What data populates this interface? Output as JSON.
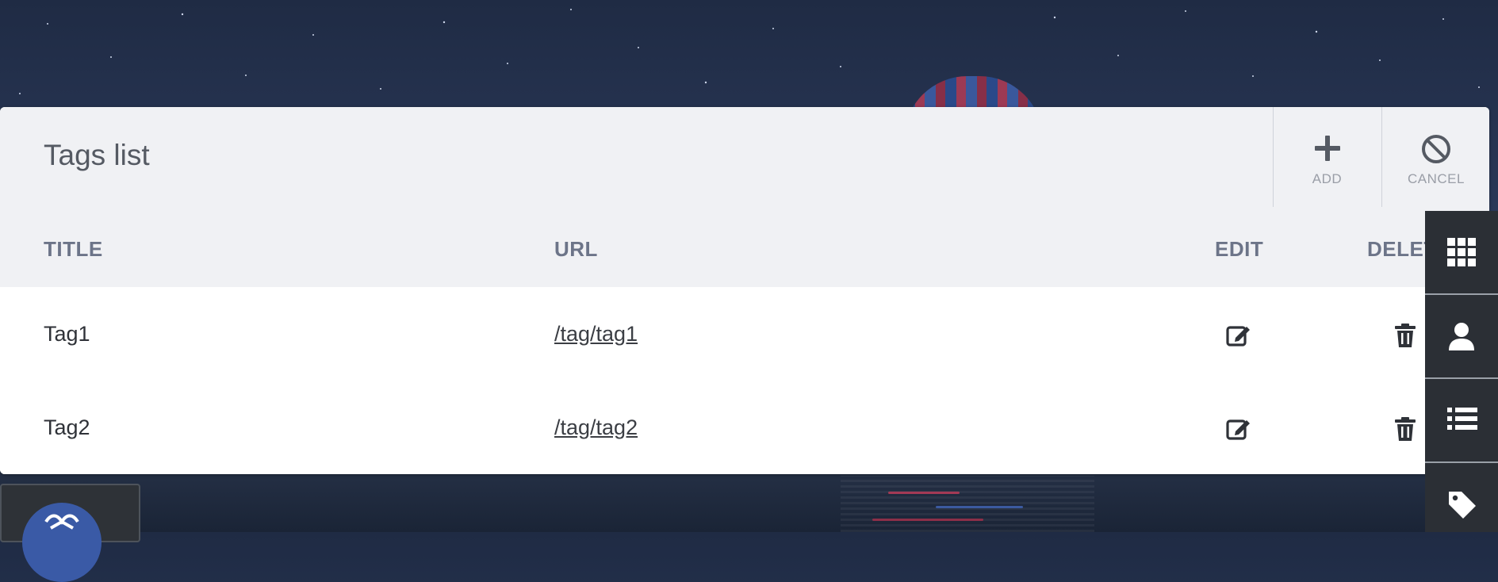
{
  "panel": {
    "title": "Tags list",
    "actions": [
      {
        "label": "ADD",
        "icon": "plus-icon"
      },
      {
        "label": "CANCEL",
        "icon": "cancel-icon"
      }
    ]
  },
  "table": {
    "headers": [
      "TITLE",
      "URL",
      "EDIT",
      "DELETE"
    ],
    "rows": [
      {
        "title": "Tag1",
        "url": "/tag/tag1"
      },
      {
        "title": "Tag2",
        "url": "/tag/tag2"
      }
    ]
  },
  "sidebar": {
    "items": [
      {
        "icon": "grid-icon"
      },
      {
        "icon": "user-icon"
      },
      {
        "icon": "list-icon"
      },
      {
        "icon": "tag-icon"
      }
    ]
  },
  "colors": {
    "panel_bg": "#f0f1f4",
    "header_text": "#6c7488",
    "sidebar_bg": "#2b2f35",
    "avatar": "#3a5aa6"
  }
}
